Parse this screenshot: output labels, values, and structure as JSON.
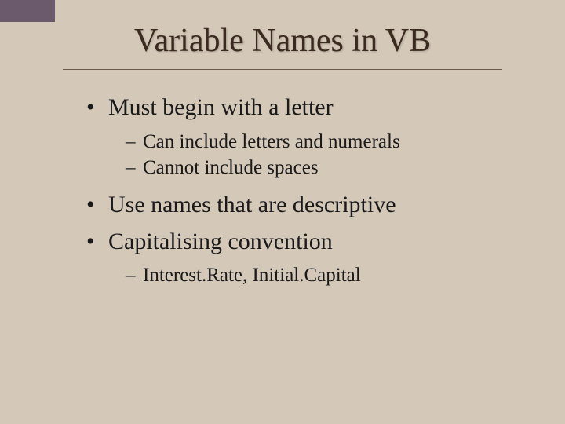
{
  "slide": {
    "title": "Variable Names in VB",
    "bullets": [
      {
        "text": "Must begin with a letter",
        "sub": [
          "Can include letters and numerals",
          "Cannot include spaces"
        ]
      },
      {
        "text": "Use names that are descriptive",
        "sub": []
      },
      {
        "text": "Capitalising  convention",
        "sub": [
          "Interest.Rate, Initial.Capital"
        ]
      }
    ]
  }
}
